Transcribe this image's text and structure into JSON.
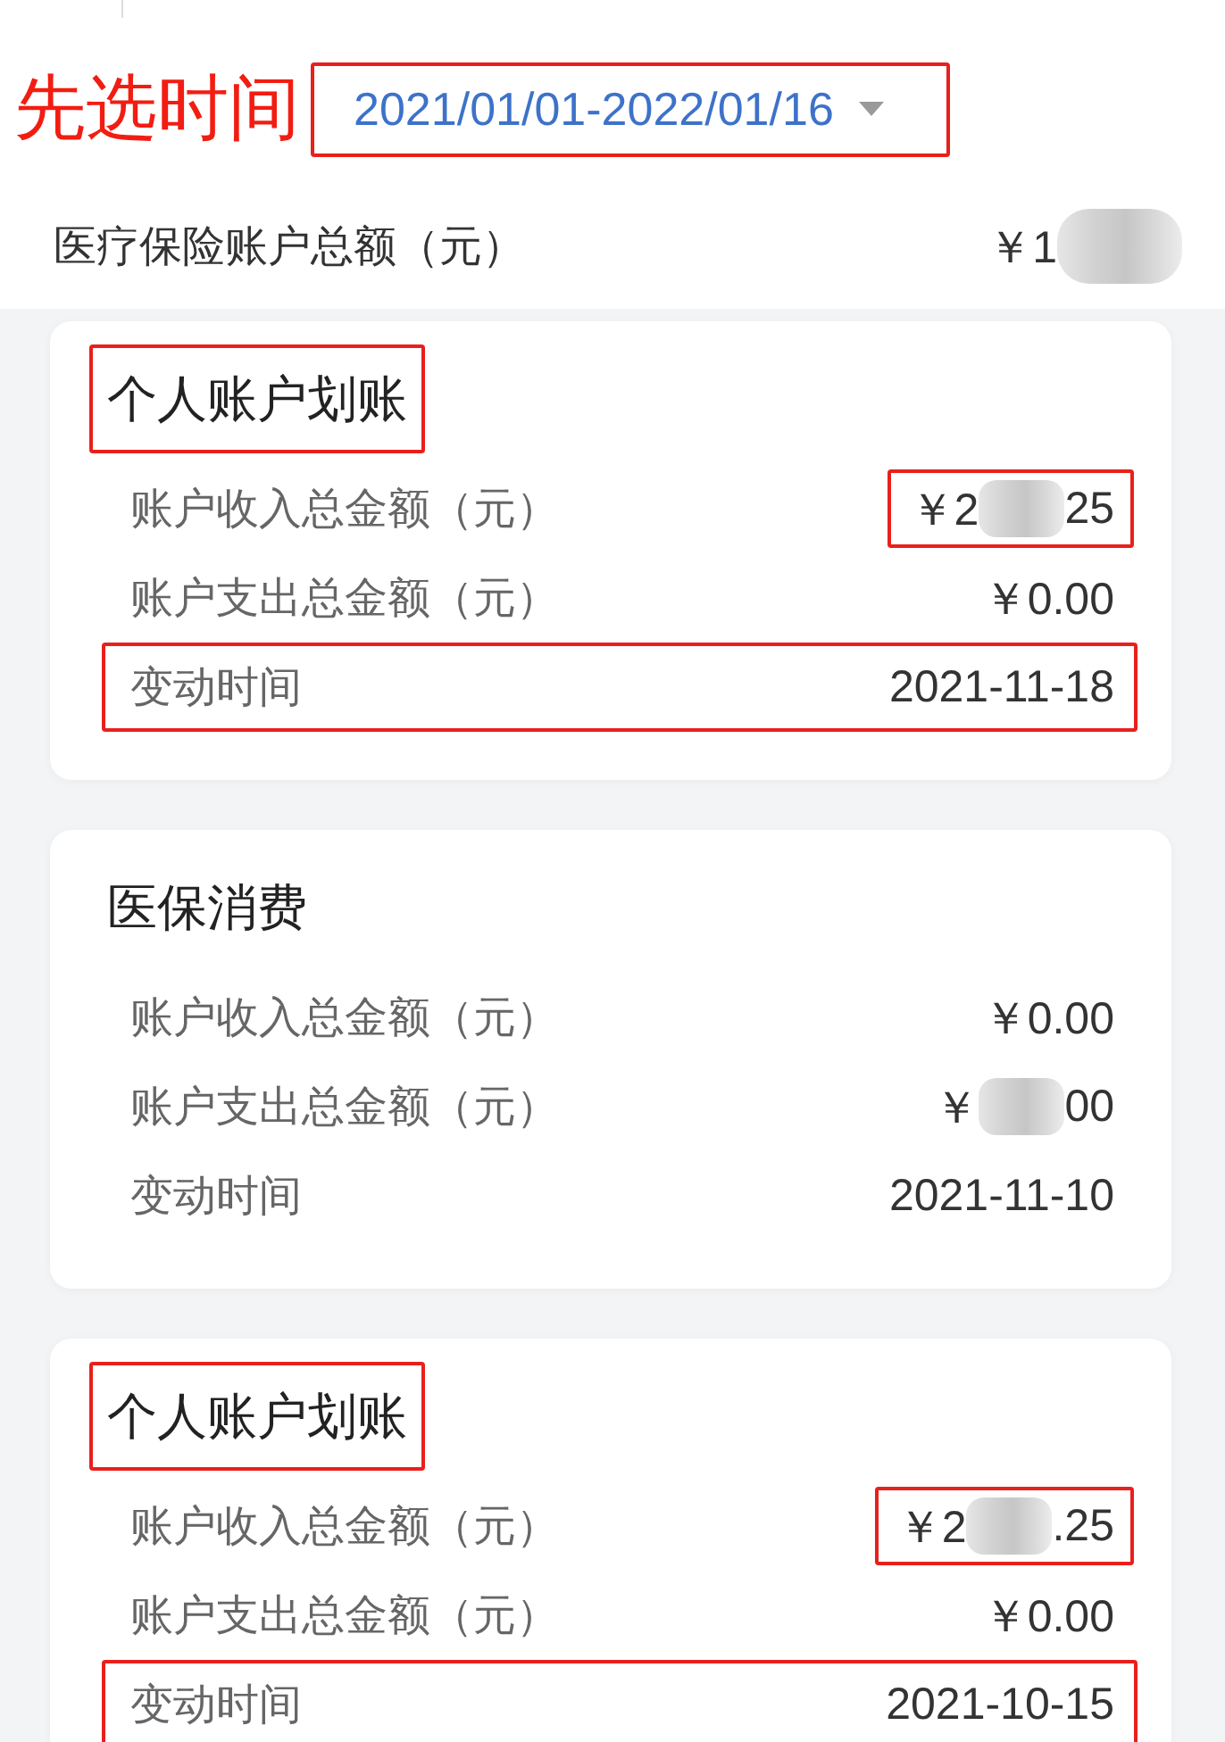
{
  "annotation": {
    "text": "先选时间"
  },
  "date_filter": {
    "value": "2021/01/01-2022/01/16",
    "highlighted": true
  },
  "balance": {
    "label": "医疗保险账户总额（元）",
    "value_parts": [
      {
        "kind": "text",
        "text": "￥1"
      },
      {
        "kind": "redacted"
      }
    ]
  },
  "cards": [
    {
      "title": {
        "text": "个人账户划账",
        "highlighted": true
      },
      "rows": [
        {
          "label": "账户收入总金额（元）",
          "value_parts": [
            {
              "kind": "text",
              "text": "￥2"
            },
            {
              "kind": "redacted"
            },
            {
              "kind": "text",
              "text": "25"
            }
          ],
          "highlighted": false,
          "value_highlighted": true
        },
        {
          "label": "账户支出总金额（元）",
          "value_parts": [
            {
              "kind": "text",
              "text": "￥0.00"
            }
          ],
          "highlighted": false,
          "value_highlighted": false
        },
        {
          "label": "变动时间",
          "value_parts": [
            {
              "kind": "text",
              "text": "2021-11-18"
            }
          ],
          "highlighted": true,
          "value_highlighted": false
        }
      ]
    },
    {
      "title": {
        "text": "医保消费",
        "highlighted": false
      },
      "rows": [
        {
          "label": "账户收入总金额（元）",
          "value_parts": [
            {
              "kind": "text",
              "text": "￥0.00"
            }
          ],
          "highlighted": false,
          "value_highlighted": false
        },
        {
          "label": "账户支出总金额（元）",
          "value_parts": [
            {
              "kind": "text",
              "text": "￥"
            },
            {
              "kind": "redacted"
            },
            {
              "kind": "text",
              "text": "00"
            }
          ],
          "highlighted": false,
          "value_highlighted": false
        },
        {
          "label": "变动时间",
          "value_parts": [
            {
              "kind": "text",
              "text": "2021-11-10"
            }
          ],
          "highlighted": false,
          "value_highlighted": false
        }
      ]
    },
    {
      "title": {
        "text": "个人账户划账",
        "highlighted": true
      },
      "rows": [
        {
          "label": "账户收入总金额（元）",
          "value_parts": [
            {
              "kind": "text",
              "text": "￥2"
            },
            {
              "kind": "redacted"
            },
            {
              "kind": "text",
              "text": ".25"
            }
          ],
          "highlighted": false,
          "value_highlighted": true
        },
        {
          "label": "账户支出总金额（元）",
          "value_parts": [
            {
              "kind": "text",
              "text": "￥0.00"
            }
          ],
          "highlighted": false,
          "value_highlighted": false
        },
        {
          "label": "变动时间",
          "value_parts": [
            {
              "kind": "text",
              "text": "2021-10-15"
            }
          ],
          "highlighted": true,
          "value_highlighted": false
        }
      ]
    }
  ]
}
